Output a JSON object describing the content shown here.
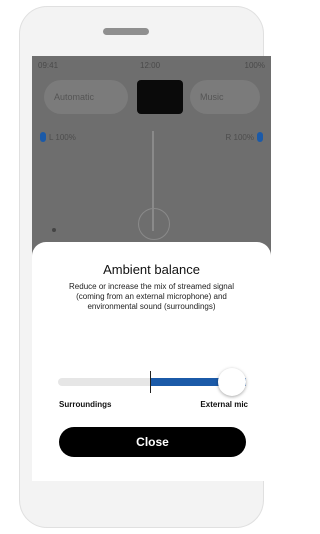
{
  "sheet": {
    "title": "Ambient balance",
    "description": "Reduce or increase the mix of streamed signal (coming from an external microphone) and environmental sound (surroundings)",
    "slider": {
      "left_label": "Surroundings",
      "right_label": "External mic",
      "value_fraction": 0.92
    },
    "close_label": "Close"
  },
  "background_app": {
    "status_left": "09:41",
    "status_center": "12:00",
    "status_right": "100%",
    "program_left": "Automatic",
    "program_right": "Music",
    "volume_left": "L 100%",
    "volume_right": "R 100%"
  },
  "colors": {
    "accent": "#1b5aa8",
    "overlay": "#6e6e6e",
    "button": "#000000"
  }
}
